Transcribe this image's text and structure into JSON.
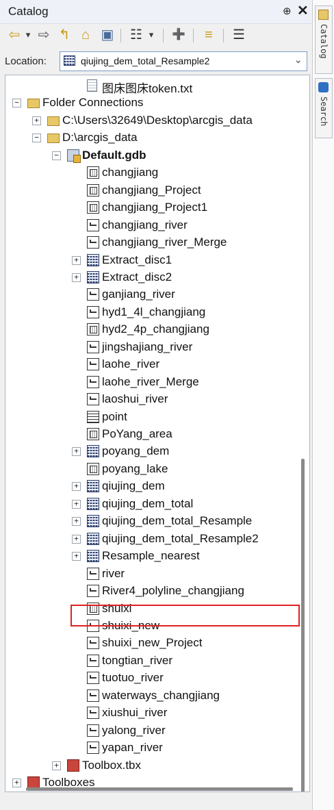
{
  "window": {
    "title": "Catalog",
    "pin_glyph": "⊕",
    "close_glyph": "✕"
  },
  "toolbar": {
    "back_glyph": "⇦",
    "back_dropdown": "▾",
    "forward_glyph": "⇨",
    "up_glyph": "↰",
    "home_glyph": "⌂",
    "connect_glyph": "▣",
    "view_glyph": "☷",
    "view_dropdown": "▾",
    "new_glyph": "➕",
    "tree_glyph": "≡",
    "options_glyph": "☰"
  },
  "location": {
    "label": "Location:",
    "value": "qiujing_dem_total_Resample2",
    "icon": "raster-icon"
  },
  "tree": {
    "rows": [
      {
        "label": "图床图床token.txt",
        "icon": "document-icon",
        "depth": 3,
        "expander": ""
      },
      {
        "label": "Folder Connections",
        "icon": "folder-icon",
        "depth": 0,
        "expander": "−"
      },
      {
        "label": "C:\\Users\\32649\\Desktop\\arcgis_data",
        "icon": "folder-icon",
        "depth": 1,
        "expander": "+"
      },
      {
        "label": "D:\\arcgis_data",
        "icon": "folder-icon",
        "depth": 1,
        "expander": "−"
      },
      {
        "label": "Default.gdb",
        "icon": "geodatabase-icon",
        "depth": 2,
        "expander": "−",
        "bold": true
      },
      {
        "label": "changjiang",
        "icon": "polygon-icon",
        "depth": 3,
        "expander": ""
      },
      {
        "label": "changjiang_Project",
        "icon": "polygon-icon",
        "depth": 3,
        "expander": ""
      },
      {
        "label": "changjiang_Project1",
        "icon": "polygon-icon",
        "depth": 3,
        "expander": ""
      },
      {
        "label": "changjiang_river",
        "icon": "polyline-icon",
        "depth": 3,
        "expander": ""
      },
      {
        "label": "changjiang_river_Merge",
        "icon": "polyline-icon",
        "depth": 3,
        "expander": ""
      },
      {
        "label": "Extract_disc1",
        "icon": "raster-icon",
        "depth": 3,
        "expander": "+"
      },
      {
        "label": "Extract_disc2",
        "icon": "raster-icon",
        "depth": 3,
        "expander": "+"
      },
      {
        "label": "ganjiang_river",
        "icon": "polyline-icon",
        "depth": 3,
        "expander": ""
      },
      {
        "label": "hyd1_4l_changjiang",
        "icon": "polyline-icon",
        "depth": 3,
        "expander": ""
      },
      {
        "label": "hyd2_4p_changjiang",
        "icon": "polygon-icon",
        "depth": 3,
        "expander": ""
      },
      {
        "label": "jingshajiang_river",
        "icon": "polyline-icon",
        "depth": 3,
        "expander": ""
      },
      {
        "label": "laohe_river",
        "icon": "polyline-icon",
        "depth": 3,
        "expander": ""
      },
      {
        "label": "laohe_river_Merge",
        "icon": "polyline-icon",
        "depth": 3,
        "expander": ""
      },
      {
        "label": "laoshui_river",
        "icon": "polyline-icon",
        "depth": 3,
        "expander": ""
      },
      {
        "label": "point",
        "icon": "table-icon",
        "depth": 3,
        "expander": ""
      },
      {
        "label": "PoYang_area",
        "icon": "polygon-icon",
        "depth": 3,
        "expander": ""
      },
      {
        "label": "poyang_dem",
        "icon": "raster-icon",
        "depth": 3,
        "expander": "+"
      },
      {
        "label": "poyang_lake",
        "icon": "polygon-icon",
        "depth": 3,
        "expander": ""
      },
      {
        "label": "qiujing_dem",
        "icon": "raster-icon",
        "depth": 3,
        "expander": "+"
      },
      {
        "label": "qiujing_dem_total",
        "icon": "raster-icon",
        "depth": 3,
        "expander": "+"
      },
      {
        "label": "qiujing_dem_total_Resample",
        "icon": "raster-icon",
        "depth": 3,
        "expander": "+"
      },
      {
        "label": "qiujing_dem_total_Resample2",
        "icon": "raster-icon",
        "depth": 3,
        "expander": "+",
        "selected": true
      },
      {
        "label": "Resample_nearest",
        "icon": "raster-icon",
        "depth": 3,
        "expander": "+"
      },
      {
        "label": "river",
        "icon": "polyline-icon",
        "depth": 3,
        "expander": ""
      },
      {
        "label": "River4_polyline_changjiang",
        "icon": "polyline-icon",
        "depth": 3,
        "expander": ""
      },
      {
        "label": "shuixi",
        "icon": "polygon-icon",
        "depth": 3,
        "expander": ""
      },
      {
        "label": "shuixi_new",
        "icon": "polyline-icon",
        "depth": 3,
        "expander": ""
      },
      {
        "label": "shuixi_new_Project",
        "icon": "polyline-icon",
        "depth": 3,
        "expander": ""
      },
      {
        "label": "tongtian_river",
        "icon": "polyline-icon",
        "depth": 3,
        "expander": ""
      },
      {
        "label": "tuotuo_river",
        "icon": "polyline-icon",
        "depth": 3,
        "expander": ""
      },
      {
        "label": "waterways_changjiang",
        "icon": "polyline-icon",
        "depth": 3,
        "expander": ""
      },
      {
        "label": "xiushui_river",
        "icon": "polyline-icon",
        "depth": 3,
        "expander": ""
      },
      {
        "label": "yalong_river",
        "icon": "polyline-icon",
        "depth": 3,
        "expander": ""
      },
      {
        "label": "yapan_river",
        "icon": "polyline-icon",
        "depth": 3,
        "expander": ""
      },
      {
        "label": "Toolbox.tbx",
        "icon": "toolbox-icon",
        "depth": 2,
        "expander": "+"
      },
      {
        "label": "Toolboxes",
        "icon": "toolboxes-icon",
        "depth": 0,
        "expander": "+"
      }
    ]
  },
  "side_tabs": [
    {
      "label": "Catalog",
      "icon": "catalog-icon"
    },
    {
      "label": "Search",
      "icon": "search-icon"
    }
  ]
}
